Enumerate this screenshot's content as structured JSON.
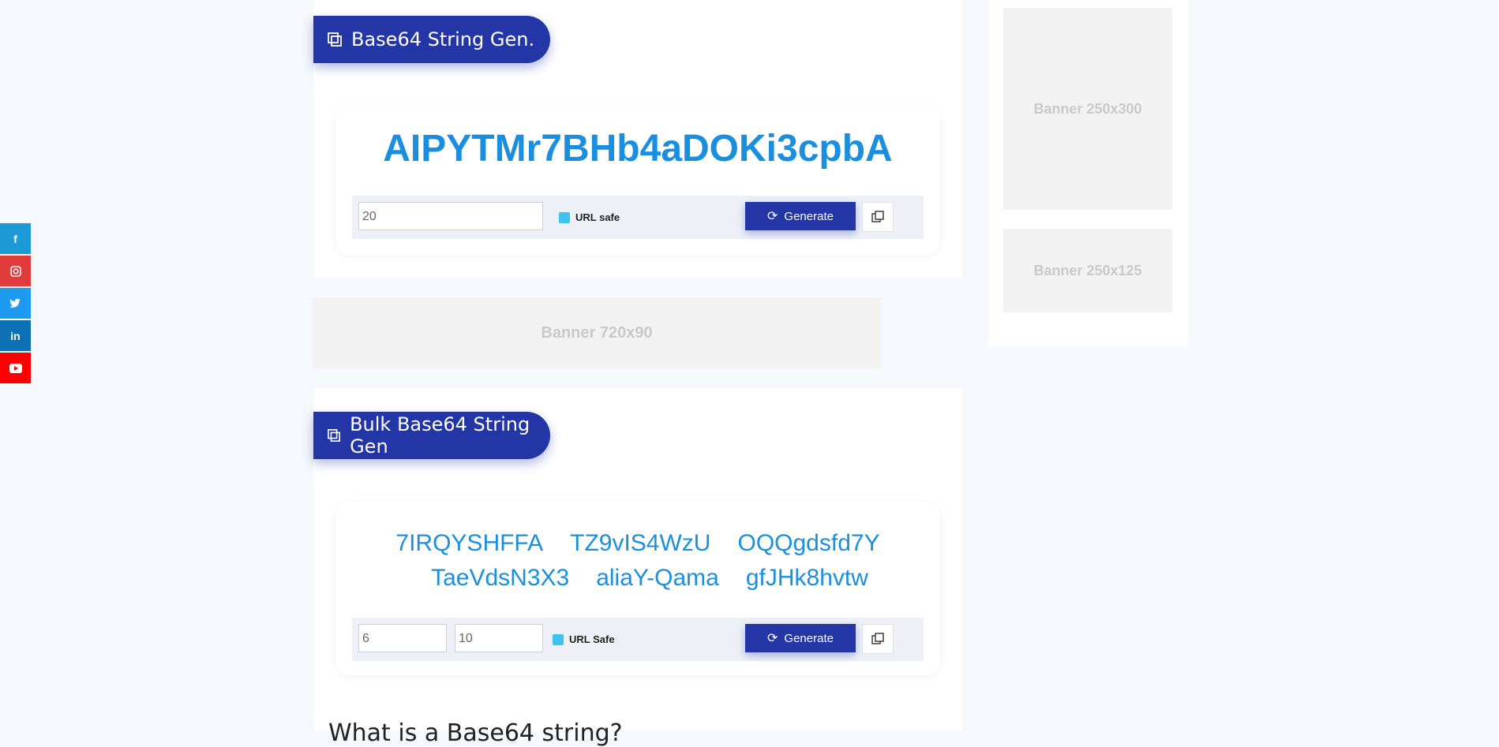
{
  "single": {
    "title": "Base64 String Gen.",
    "result": "AIPYTMr7BHb4aDOKi3cpbA",
    "length_value": "20",
    "url_safe_label": "URL safe",
    "generate_label": "Generate"
  },
  "bulk": {
    "title": "Bulk Base64 String Gen",
    "results_row1": [
      "7IRQYSHFFA",
      "TZ9vIS4WzU",
      "OQQgdsfd7Y"
    ],
    "results_row2": [
      "TaeVdsN3X3",
      "aliaY-Qama",
      "gfJHk8hvtw"
    ],
    "count_value": "6",
    "length_value": "10",
    "url_safe_label": "URL Safe",
    "generate_label": "Generate"
  },
  "banners": {
    "top_right": "Banner  250x300",
    "mid_right": "Banner  250x125",
    "leaderboard": "Banner  720x90"
  },
  "article": {
    "heading": "What is a Base64 string?"
  },
  "social": [
    "facebook-icon",
    "instagram-icon",
    "twitter-icon",
    "linkedin-icon",
    "youtube-icon"
  ],
  "colors": {
    "accent": "#2436a6",
    "result_text": "#1a8fe0",
    "checkbox": "#3cc3f2"
  }
}
